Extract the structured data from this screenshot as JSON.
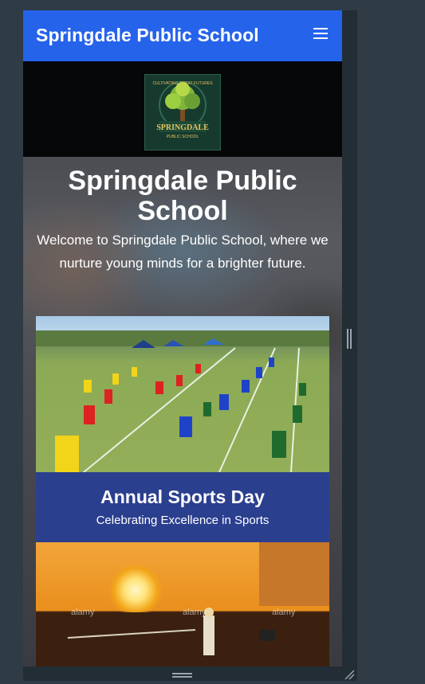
{
  "navbar": {
    "brand": "Springdale Public School",
    "menu_icon": "hamburger-menu-icon"
  },
  "logo": {
    "arc_text": "CULTIVATING GREAT FUTURES",
    "name": "SPRINGDALE",
    "subtitle": "PUBLIC SCHOOL"
  },
  "hero": {
    "title": "Springdale Public School",
    "subtitle": "Welcome to Springdale Public School, where we nurture young minds for a brighter future."
  },
  "cards": [
    {
      "title": "Annual Sports Day",
      "subtitle": "Celebrating Excellence in Sports"
    },
    {
      "watermark": "alamy"
    }
  ],
  "colors": {
    "navbar": "#2563eb",
    "caption": "#2b3f8f",
    "frame": "#2f3c46"
  }
}
